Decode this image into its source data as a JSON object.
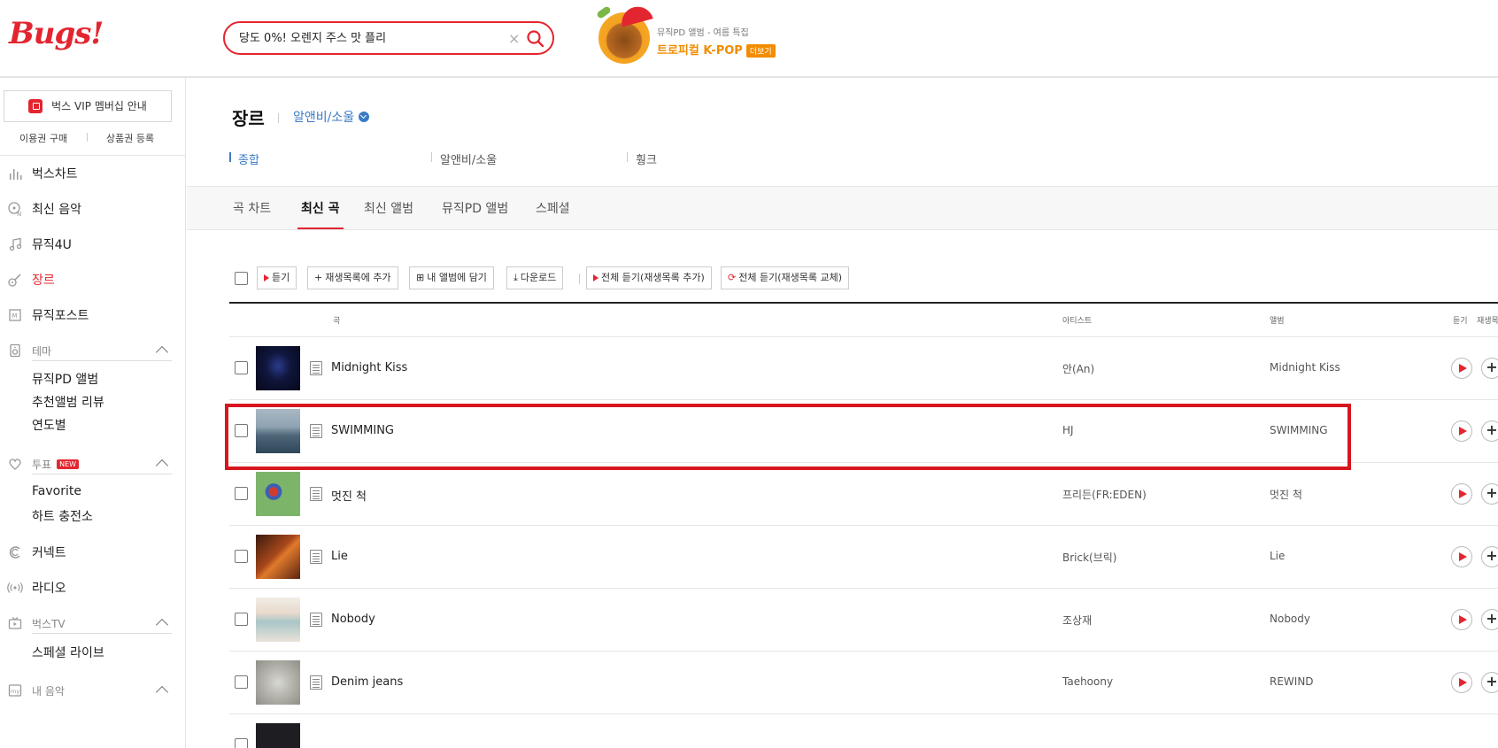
{
  "header": {
    "logo": "Bugs!",
    "search": {
      "value": "당도 0%! 오렌지 주스 맛 플리",
      "clear": "×"
    },
    "promo": {
      "subtitle": "뮤직PD 앨범 - 여름 특집",
      "title": "트로피컬 K-POP",
      "more": "더보기"
    }
  },
  "sidebar": {
    "vip": "벅스 VIP 멤버십 안내",
    "buy": "이용권 구매",
    "coupon": "상품권 등록",
    "nav": {
      "chart": "벅스차트",
      "new_music": "최신 음악",
      "music4u": "뮤직4U",
      "genre": "장르",
      "musicpost": "뮤직포스트",
      "theme": "테마",
      "theme_items": [
        "뮤직PD 앨범",
        "추천앨범 리뷰",
        "연도별"
      ],
      "vote": "투표",
      "vote_badge": "NEW",
      "vote_items": [
        "Favorite",
        "하트 충전소"
      ],
      "connect": "커넥트",
      "radio": "라디오",
      "bugstv": "벅스TV",
      "bugstv_items": [
        "스페셜 라이브"
      ],
      "my_music": "내 음악"
    }
  },
  "main": {
    "page_title": "장르",
    "genre_select": "알앤비/소울",
    "genre_tabs": [
      "종합",
      "알앤비/소울",
      "훵크"
    ],
    "tabs": [
      "곡 차트",
      "최신 곡",
      "최신 앨범",
      "뮤직PD 앨범",
      "스페셜"
    ],
    "toolbar": {
      "listen": "듣기",
      "add_playlist": "재생목록에 추가",
      "add_album": "내 앨범에 담기",
      "download": "다운로드",
      "listen_all_add": "전체 듣기(재생목록 추가)",
      "listen_all_replace": "전체 듣기(재생목록 교체)"
    },
    "columns": {
      "song": "곡",
      "artist": "아티스트",
      "album": "앨범",
      "listen": "듣기",
      "playlist": "재생목"
    },
    "rows": [
      {
        "title": "Midnight Kiss",
        "artist": "안(An)",
        "album": "Midnight Kiss"
      },
      {
        "title": "SWIMMING",
        "artist": "HJ",
        "album": "SWIMMING"
      },
      {
        "title": "멋진 척",
        "artist": "프리든(FR:EDEN)",
        "album": "멋진 척"
      },
      {
        "title": "Lie",
        "artist": "Brick(브릭)",
        "album": "Lie"
      },
      {
        "title": "Nobody",
        "artist": "조상재",
        "album": "Nobody"
      },
      {
        "title": "Denim jeans",
        "artist": "Taehoony",
        "album": "REWIND"
      }
    ]
  },
  "colors": {
    "accent": "#e3252f",
    "link": "#3b7bc6",
    "highlight": "#d7161e"
  }
}
